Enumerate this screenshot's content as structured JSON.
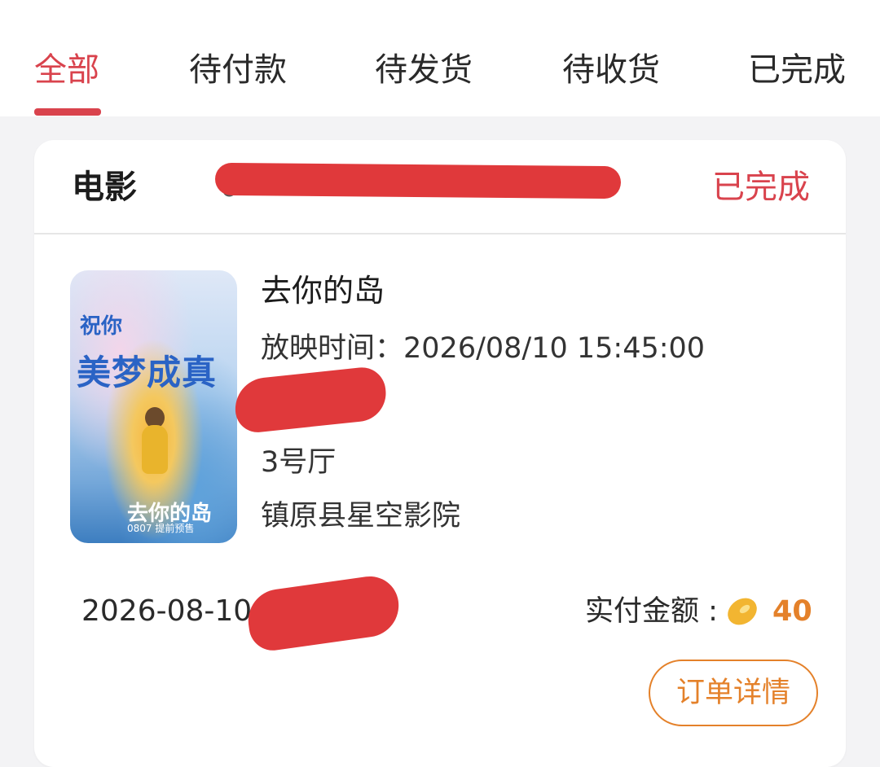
{
  "tabs": [
    {
      "label": "全部",
      "active": true
    },
    {
      "label": "待付款",
      "active": false
    },
    {
      "label": "待发货",
      "active": false
    },
    {
      "label": "待收货",
      "active": false
    },
    {
      "label": "已完成",
      "active": false
    }
  ],
  "order": {
    "category": "电影",
    "order_no_visible": "0",
    "status": "已完成",
    "poster": {
      "line1": "祝你",
      "line2": "美梦成真",
      "logo": "去你的岛",
      "date": "0807 提前预售"
    },
    "movie_title": "去你的岛",
    "showtime_label": "放映时间：",
    "showtime_value": "2026/08/10 15:45:00",
    "hall": "3号厅",
    "cinema": "镇原县星空影院",
    "order_time_visible": "2026-08-10 1",
    "paid_label": "实付金额 :",
    "paid_amount": "40",
    "detail_button": "订单详情"
  },
  "colors": {
    "accent_red": "#d9434d",
    "redaction": "#e0393b",
    "amount_orange": "#e4812a",
    "coin_yellow": "#f2b531"
  },
  "icons": {
    "coin": "coin-icon"
  }
}
